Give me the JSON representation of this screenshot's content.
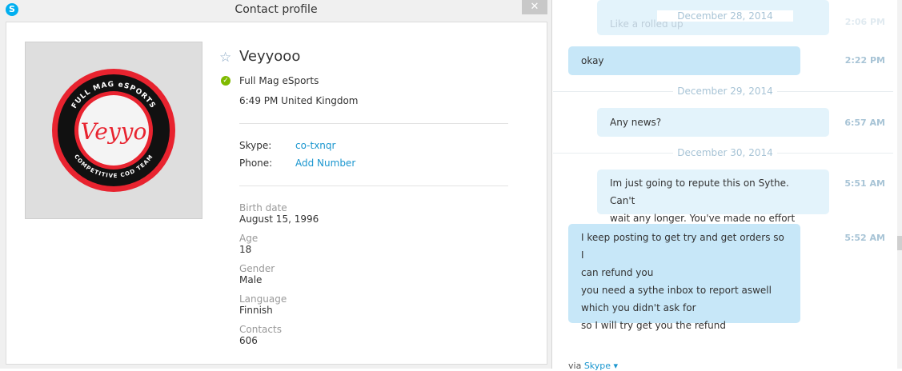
{
  "dialog": {
    "title": "Contact profile",
    "close_glyph": "✕"
  },
  "profile": {
    "name": "Veyyooo",
    "avatar_text_top": "FULL MAG eSPORTS",
    "avatar_text_center": "Veyyo",
    "avatar_text_bottom": "COMPETITIVE COD TEAM",
    "mood": "Full Mag eSports",
    "local_time": "6:49 PM United Kingdom",
    "skype_label": "Skype:",
    "skype_value": "co-txnqr",
    "phone_label": "Phone:",
    "phone_value": "Add Number",
    "fields": [
      {
        "label": "Birth date",
        "value": "August 15, 1996"
      },
      {
        "label": "Age",
        "value": "18"
      },
      {
        "label": "Gender",
        "value": "Male"
      },
      {
        "label": "Language",
        "value": "Finnish"
      },
      {
        "label": "Contacts",
        "value": "606"
      }
    ]
  },
  "chat": {
    "dates": [
      "December 28, 2014",
      "December 29, 2014",
      "December 30, 2014"
    ],
    "partial_message": "Like a rolled up",
    "partial_time": "2:06 PM",
    "messages": [
      {
        "text": "okay",
        "time": "2:22 PM"
      },
      {
        "text": "Any news?",
        "time": "6:57 AM"
      },
      {
        "lines": [
          "Im just going to repute this on Sythe. Can't",
          "wait any longer. You've made no effort"
        ],
        "time": "5:51 AM"
      },
      {
        "lines": [
          "I keep posting to get try and get orders so I",
          "can refund you",
          "you need a sythe inbox to report aswell",
          "which you didn't ask for",
          "so I will try get you the refund"
        ],
        "time": "5:52 AM"
      }
    ],
    "via_prefix": "via",
    "via_link": "Skype ▾"
  },
  "colors": {
    "accent": "#1a96cf",
    "incoming_bubble": "#c7e7f8",
    "outgoing_bubble": "#e3f3fb",
    "online": "#7fba00"
  }
}
